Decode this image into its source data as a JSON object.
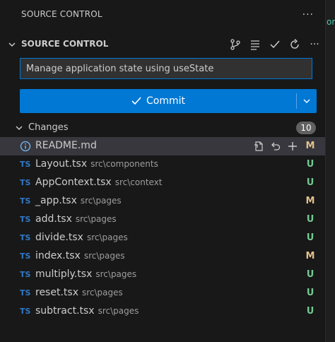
{
  "panel": {
    "title": "SOURCE CONTROL",
    "more": "···"
  },
  "right_strip": {
    "peek_text": "on"
  },
  "section": {
    "label": "SOURCE CONTROL"
  },
  "message": {
    "value": "Manage application state using useState"
  },
  "commit": {
    "label": "Commit"
  },
  "changes": {
    "label": "Changes",
    "count": "10",
    "files": [
      {
        "name": "README.md",
        "path": "",
        "status": "M",
        "icon": "info-icon"
      },
      {
        "name": "Layout.tsx",
        "path": "src\\components",
        "status": "U",
        "icon": "TS"
      },
      {
        "name": "AppContext.tsx",
        "path": "src\\context",
        "status": "U",
        "icon": "TS"
      },
      {
        "name": "_app.tsx",
        "path": "src\\pages",
        "status": "M",
        "icon": "TS"
      },
      {
        "name": "add.tsx",
        "path": "src\\pages",
        "status": "U",
        "icon": "TS"
      },
      {
        "name": "divide.tsx",
        "path": "src\\pages",
        "status": "U",
        "icon": "TS"
      },
      {
        "name": "index.tsx",
        "path": "src\\pages",
        "status": "M",
        "icon": "TS"
      },
      {
        "name": "multiply.tsx",
        "path": "src\\pages",
        "status": "U",
        "icon": "TS"
      },
      {
        "name": "reset.tsx",
        "path": "src\\pages",
        "status": "U",
        "icon": "TS"
      },
      {
        "name": "subtract.tsx",
        "path": "src\\pages",
        "status": "U",
        "icon": "TS"
      }
    ]
  },
  "colors": {
    "accent": "#0078d4",
    "untracked": "#73c991",
    "modified": "#e2c08d",
    "ts": "#3178c6"
  }
}
